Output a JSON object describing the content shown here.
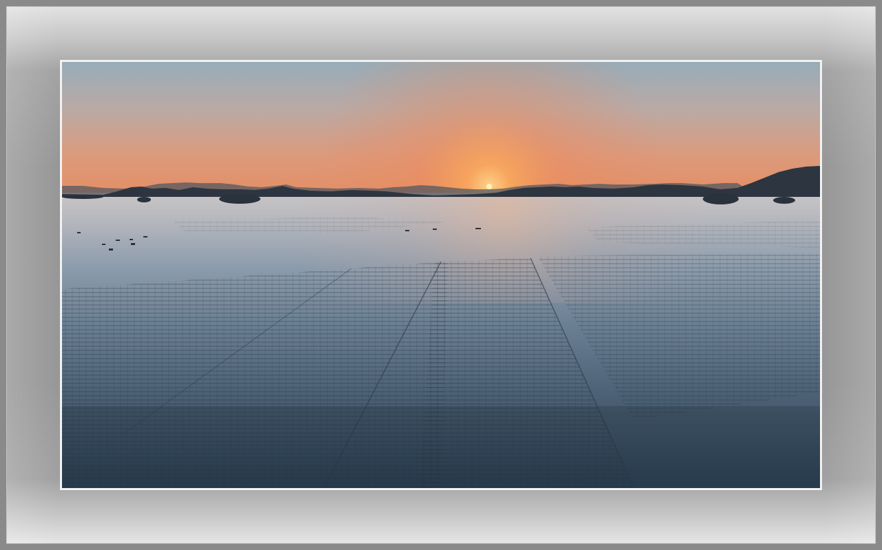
{
  "image": {
    "subject": "sunset-over-sea",
    "sky_colors": {
      "top": "#97acb8",
      "middle": "#d6a187",
      "horizon": "#f28a4f",
      "sun": "#fff3c0"
    },
    "water_colors": {
      "near_horizon": "#c7c6c8",
      "middle": "#6f8498",
      "foreground": "#2e4356"
    },
    "mountain_color": "#2d3540",
    "frame_color": "#999999"
  }
}
